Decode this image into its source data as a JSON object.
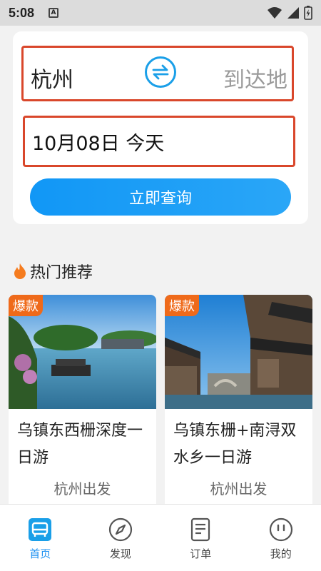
{
  "status_bar": {
    "time": "5:08",
    "app_icon_letter": "A"
  },
  "search": {
    "from_city": "杭州",
    "to_city": "到达地",
    "date": "10月08日 今天",
    "query_button": "立即查询"
  },
  "hot": {
    "title": "热门推荐",
    "cards": [
      {
        "badge": "爆款",
        "title": "乌镇东西栅深度一日游",
        "depart": "杭州出发"
      },
      {
        "badge": "爆款",
        "title": "乌镇东栅+南浔双水乡一日游",
        "depart": "杭州出发"
      }
    ]
  },
  "nav": {
    "items": [
      {
        "label": "首页",
        "icon": "home-bus-icon",
        "active": true
      },
      {
        "label": "发现",
        "icon": "compass-icon",
        "active": false
      },
      {
        "label": "订单",
        "icon": "document-icon",
        "active": false
      },
      {
        "label": "我的",
        "icon": "face-icon",
        "active": false
      }
    ]
  },
  "colors": {
    "accent": "#1a9fe8",
    "highlight_border": "#d9472b",
    "badge": "#ef6a1a"
  }
}
